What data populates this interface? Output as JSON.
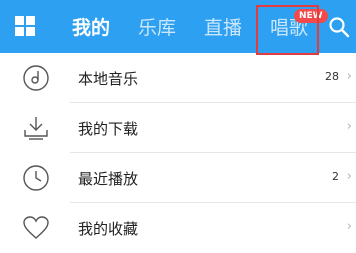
{
  "topbar": {
    "tabs": [
      {
        "label": "我的",
        "active": true
      },
      {
        "label": "乐库",
        "active": false
      },
      {
        "label": "直播",
        "active": false
      },
      {
        "label": "唱歌",
        "active": false
      }
    ],
    "badge": "NEW",
    "accent_color": "#2ea0f1",
    "highlight_color": "#e23c3c"
  },
  "list": {
    "items": [
      {
        "label": "本地音乐",
        "count": "28",
        "icon": "disc-icon"
      },
      {
        "label": "我的下载",
        "count": "",
        "icon": "download-icon"
      },
      {
        "label": "最近播放",
        "count": "2",
        "icon": "clock-icon"
      },
      {
        "label": "我的收藏",
        "count": "",
        "icon": "heart-icon"
      }
    ],
    "chevron": "›"
  }
}
